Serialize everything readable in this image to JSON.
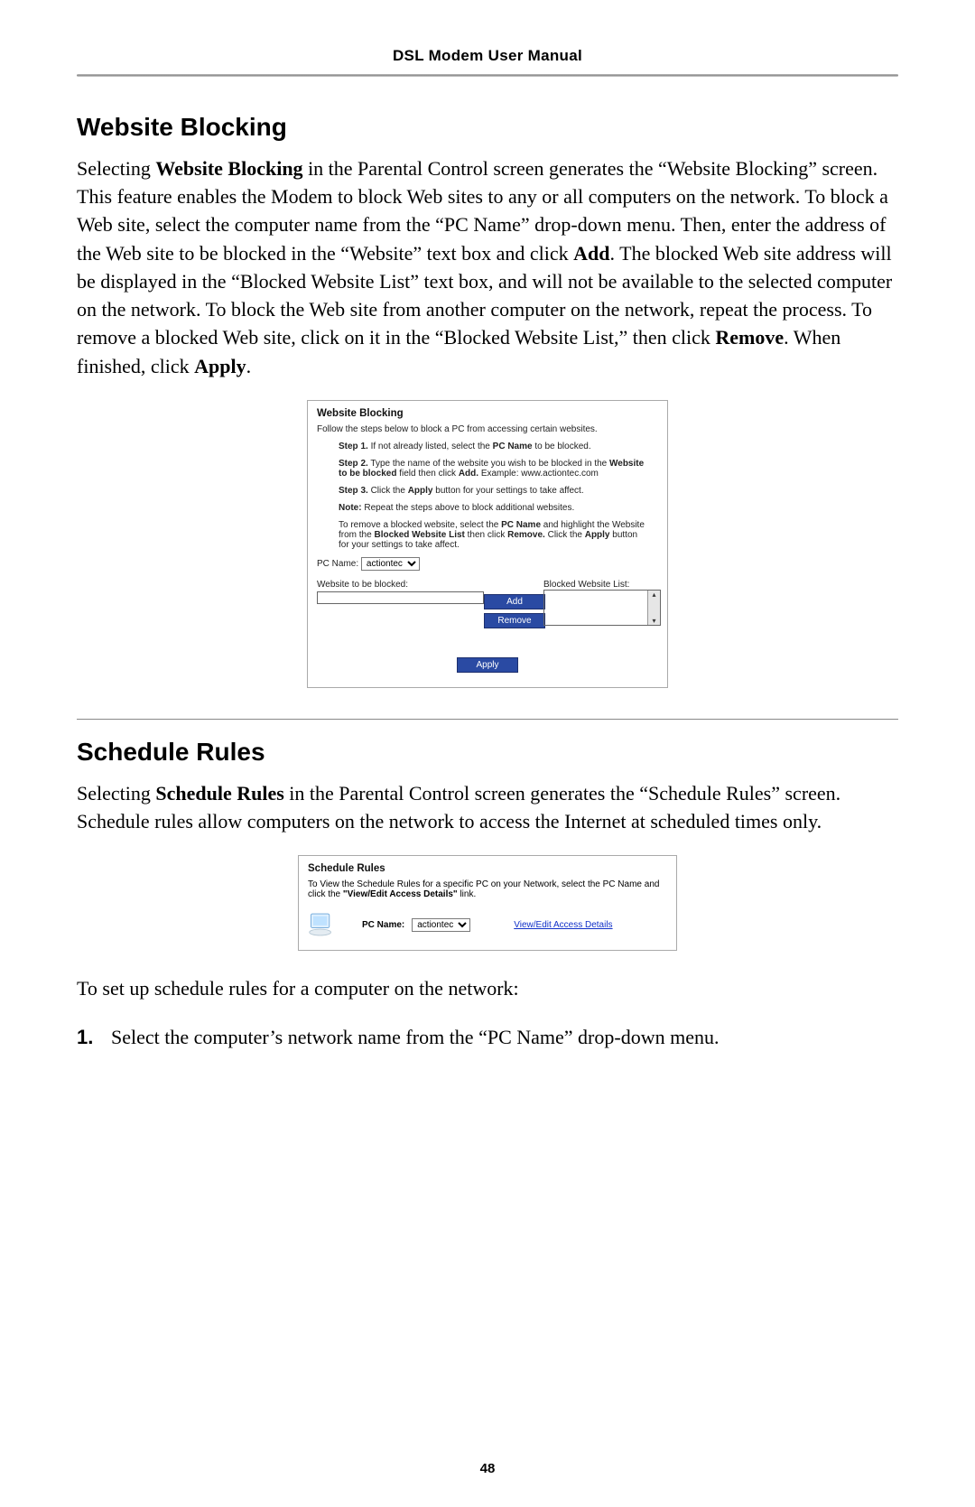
{
  "header": {
    "title": "DSL Modem User Manual"
  },
  "section1": {
    "heading": "Website Blocking",
    "body_html": "Selecting <b>Website Blocking</b> in the Parental Control screen generates the “Website Blocking” screen. This feature enables the Modem to block Web sites to any or all computers on the network. To block a Web site, select the computer name from the “PC Name” drop-down menu. Then, enter the address of the Web site to be blocked in the “Website” text box and click <b>Add</b>. The blocked Web site address will be displayed in the “Blocked Website List” text box, and will not be available to the selected computer on the network. To block the Web site from another computer on the network, repeat the process. To remove a blocked Web site, click on it in the “Blocked Website List,” then click <b>Remove</b>. When finished, click <b>Apply</b>."
  },
  "wb_screenshot": {
    "title": "Website Blocking",
    "intro": "Follow the steps below to block a PC from accessing certain websites.",
    "step1_html": "<b>Step 1.</b> If not already listed, select the <b>PC Name</b> to be blocked.",
    "step2_html": "<b>Step 2.</b> Type the name of the website you wish to be blocked in the <b>Website to be blocked</b> field then click <b>Add.</b> Example: www.actiontec.com",
    "step3_html": "<b>Step 3.</b> Click the <b>Apply</b> button for your settings to take affect.",
    "note_html": "<b>Note:</b> Repeat the steps above to block additional websites.",
    "remove_html": "To remove a blocked website, select the <b>PC Name</b> and highlight the Website from the <b>Blocked Website List</b> then click <b>Remove.</b> Click the <b>Apply</b> button for your settings to take affect.",
    "pc_name_label": "PC Name:",
    "pc_name_value": "actiontec",
    "website_label": "Website to be blocked:",
    "blocked_list_label": "Blocked Website List:",
    "btn_add": "Add",
    "btn_remove": "Remove",
    "btn_apply": "Apply"
  },
  "section2": {
    "heading": "Schedule Rules",
    "body_html": "Selecting <b>Schedule Rules</b> in the Parental Control screen generates the “Schedule Rules” screen. Schedule rules allow computers on the network to access the Internet at scheduled times only."
  },
  "sr_screenshot": {
    "title": "Schedule Rules",
    "intro_html": "To View the Schedule Rules for a specific PC on your Network, select the PC Name and click the <b>\"View/Edit Access Details\"</b> link.",
    "pc_name_label": "PC Name:",
    "pc_name_value": "actiontec",
    "link": "View/Edit Access Details"
  },
  "post": {
    "lead": "To set up schedule rules for a computer on the network:",
    "step1_num": "1.",
    "step1_text": "Select the computer’s network name from the “PC Name” drop-down menu."
  },
  "footer": {
    "page": "48"
  }
}
